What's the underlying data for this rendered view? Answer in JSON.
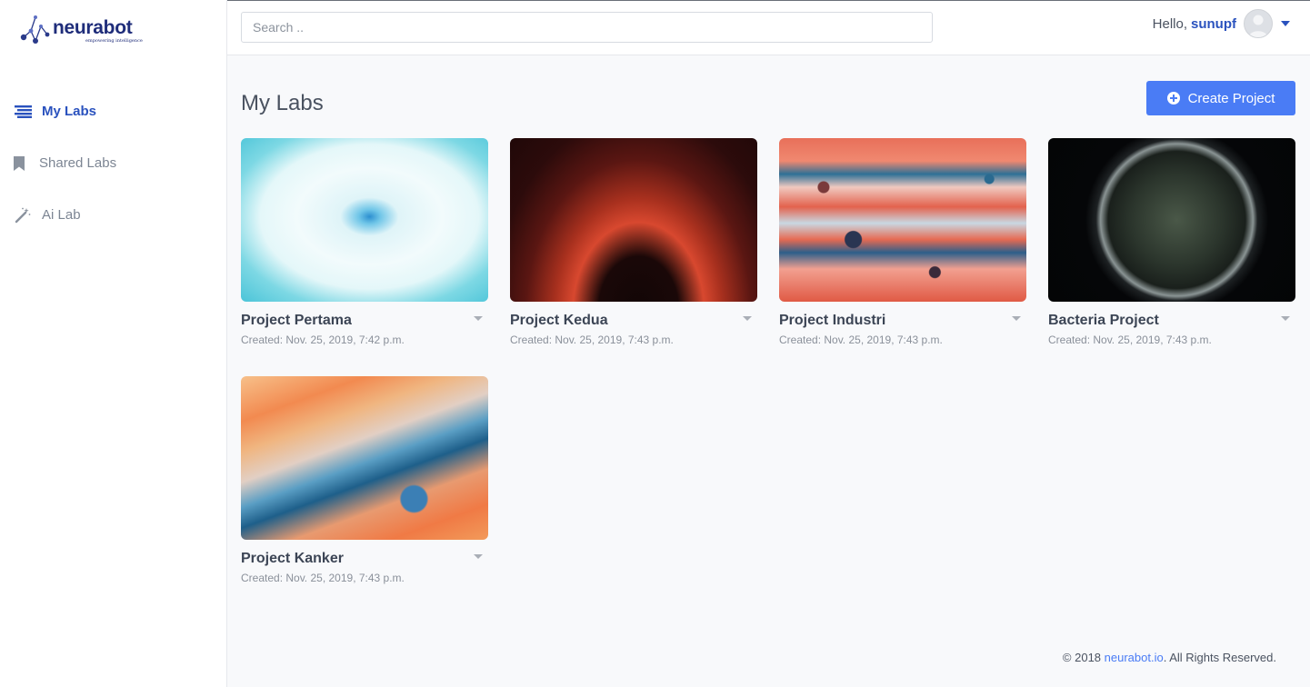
{
  "brand": {
    "name": "neurabot",
    "tagline": "empowering intelligence"
  },
  "sidebar": {
    "items": [
      {
        "label": "My Labs",
        "icon": "stack-icon",
        "active": true
      },
      {
        "label": "Shared Labs",
        "icon": "bookmark-icon",
        "active": false
      },
      {
        "label": "Ai Lab",
        "icon": "magic-wand-icon",
        "active": false
      }
    ]
  },
  "header": {
    "search_placeholder": "Search ..",
    "greeting": "Hello,",
    "username": "sunupf"
  },
  "main": {
    "title": "My Labs",
    "create_label": "Create Project",
    "projects": [
      {
        "name": "Project Pertama",
        "created": "Created: Nov. 25, 2019, 7:42 p.m."
      },
      {
        "name": "Project Kedua",
        "created": "Created: Nov. 25, 2019, 7:43 p.m."
      },
      {
        "name": "Project Industri",
        "created": "Created: Nov. 25, 2019, 7:43 p.m."
      },
      {
        "name": "Bacteria Project",
        "created": "Created: Nov. 25, 2019, 7:43 p.m."
      },
      {
        "name": "Project Kanker",
        "created": "Created: Nov. 25, 2019, 7:43 p.m."
      }
    ]
  },
  "footer": {
    "copyright": "© 2018 ",
    "link": "neurabot.io",
    "rights": ". All Rights Reserved."
  },
  "colors": {
    "accent": "#4a7cf5",
    "active_nav": "#2a52be",
    "brand": "#1f2d7a"
  }
}
